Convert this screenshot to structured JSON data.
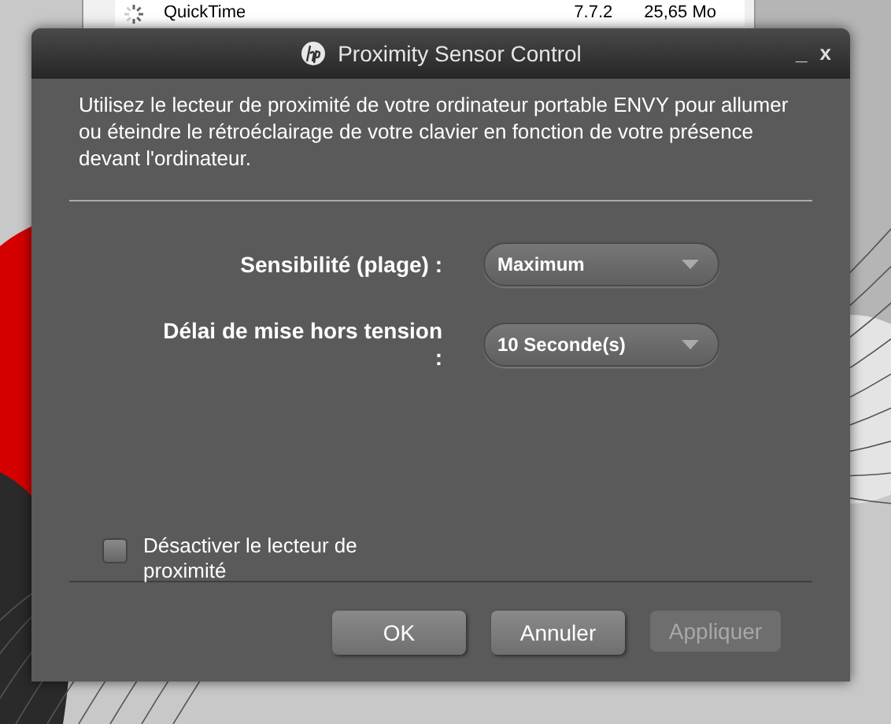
{
  "background_window": {
    "row": {
      "name": "QuickTime",
      "version": "7.7.2",
      "size": "25,65 Mo"
    }
  },
  "window": {
    "title": "Proximity Sensor Control",
    "minimize": "_",
    "close": "x"
  },
  "description": "Utilisez le lecteur de proximité de votre ordinateur portable ENVY pour allumer ou éteindre le rétroéclairage de votre clavier en fonction de votre présence devant l'ordinateur.",
  "settings": [
    {
      "label": "Sensibilité (plage) :",
      "value": "Maximum"
    },
    {
      "label": "Délai de mise hors tension :",
      "value": "10 Seconde(s)"
    }
  ],
  "disable_checkbox": {
    "label": "Désactiver le lecteur de proximité",
    "checked": false
  },
  "buttons": [
    {
      "label": "OK",
      "disabled": false
    },
    {
      "label": "Annuler",
      "disabled": false
    },
    {
      "label": "Appliquer",
      "disabled": true
    }
  ]
}
